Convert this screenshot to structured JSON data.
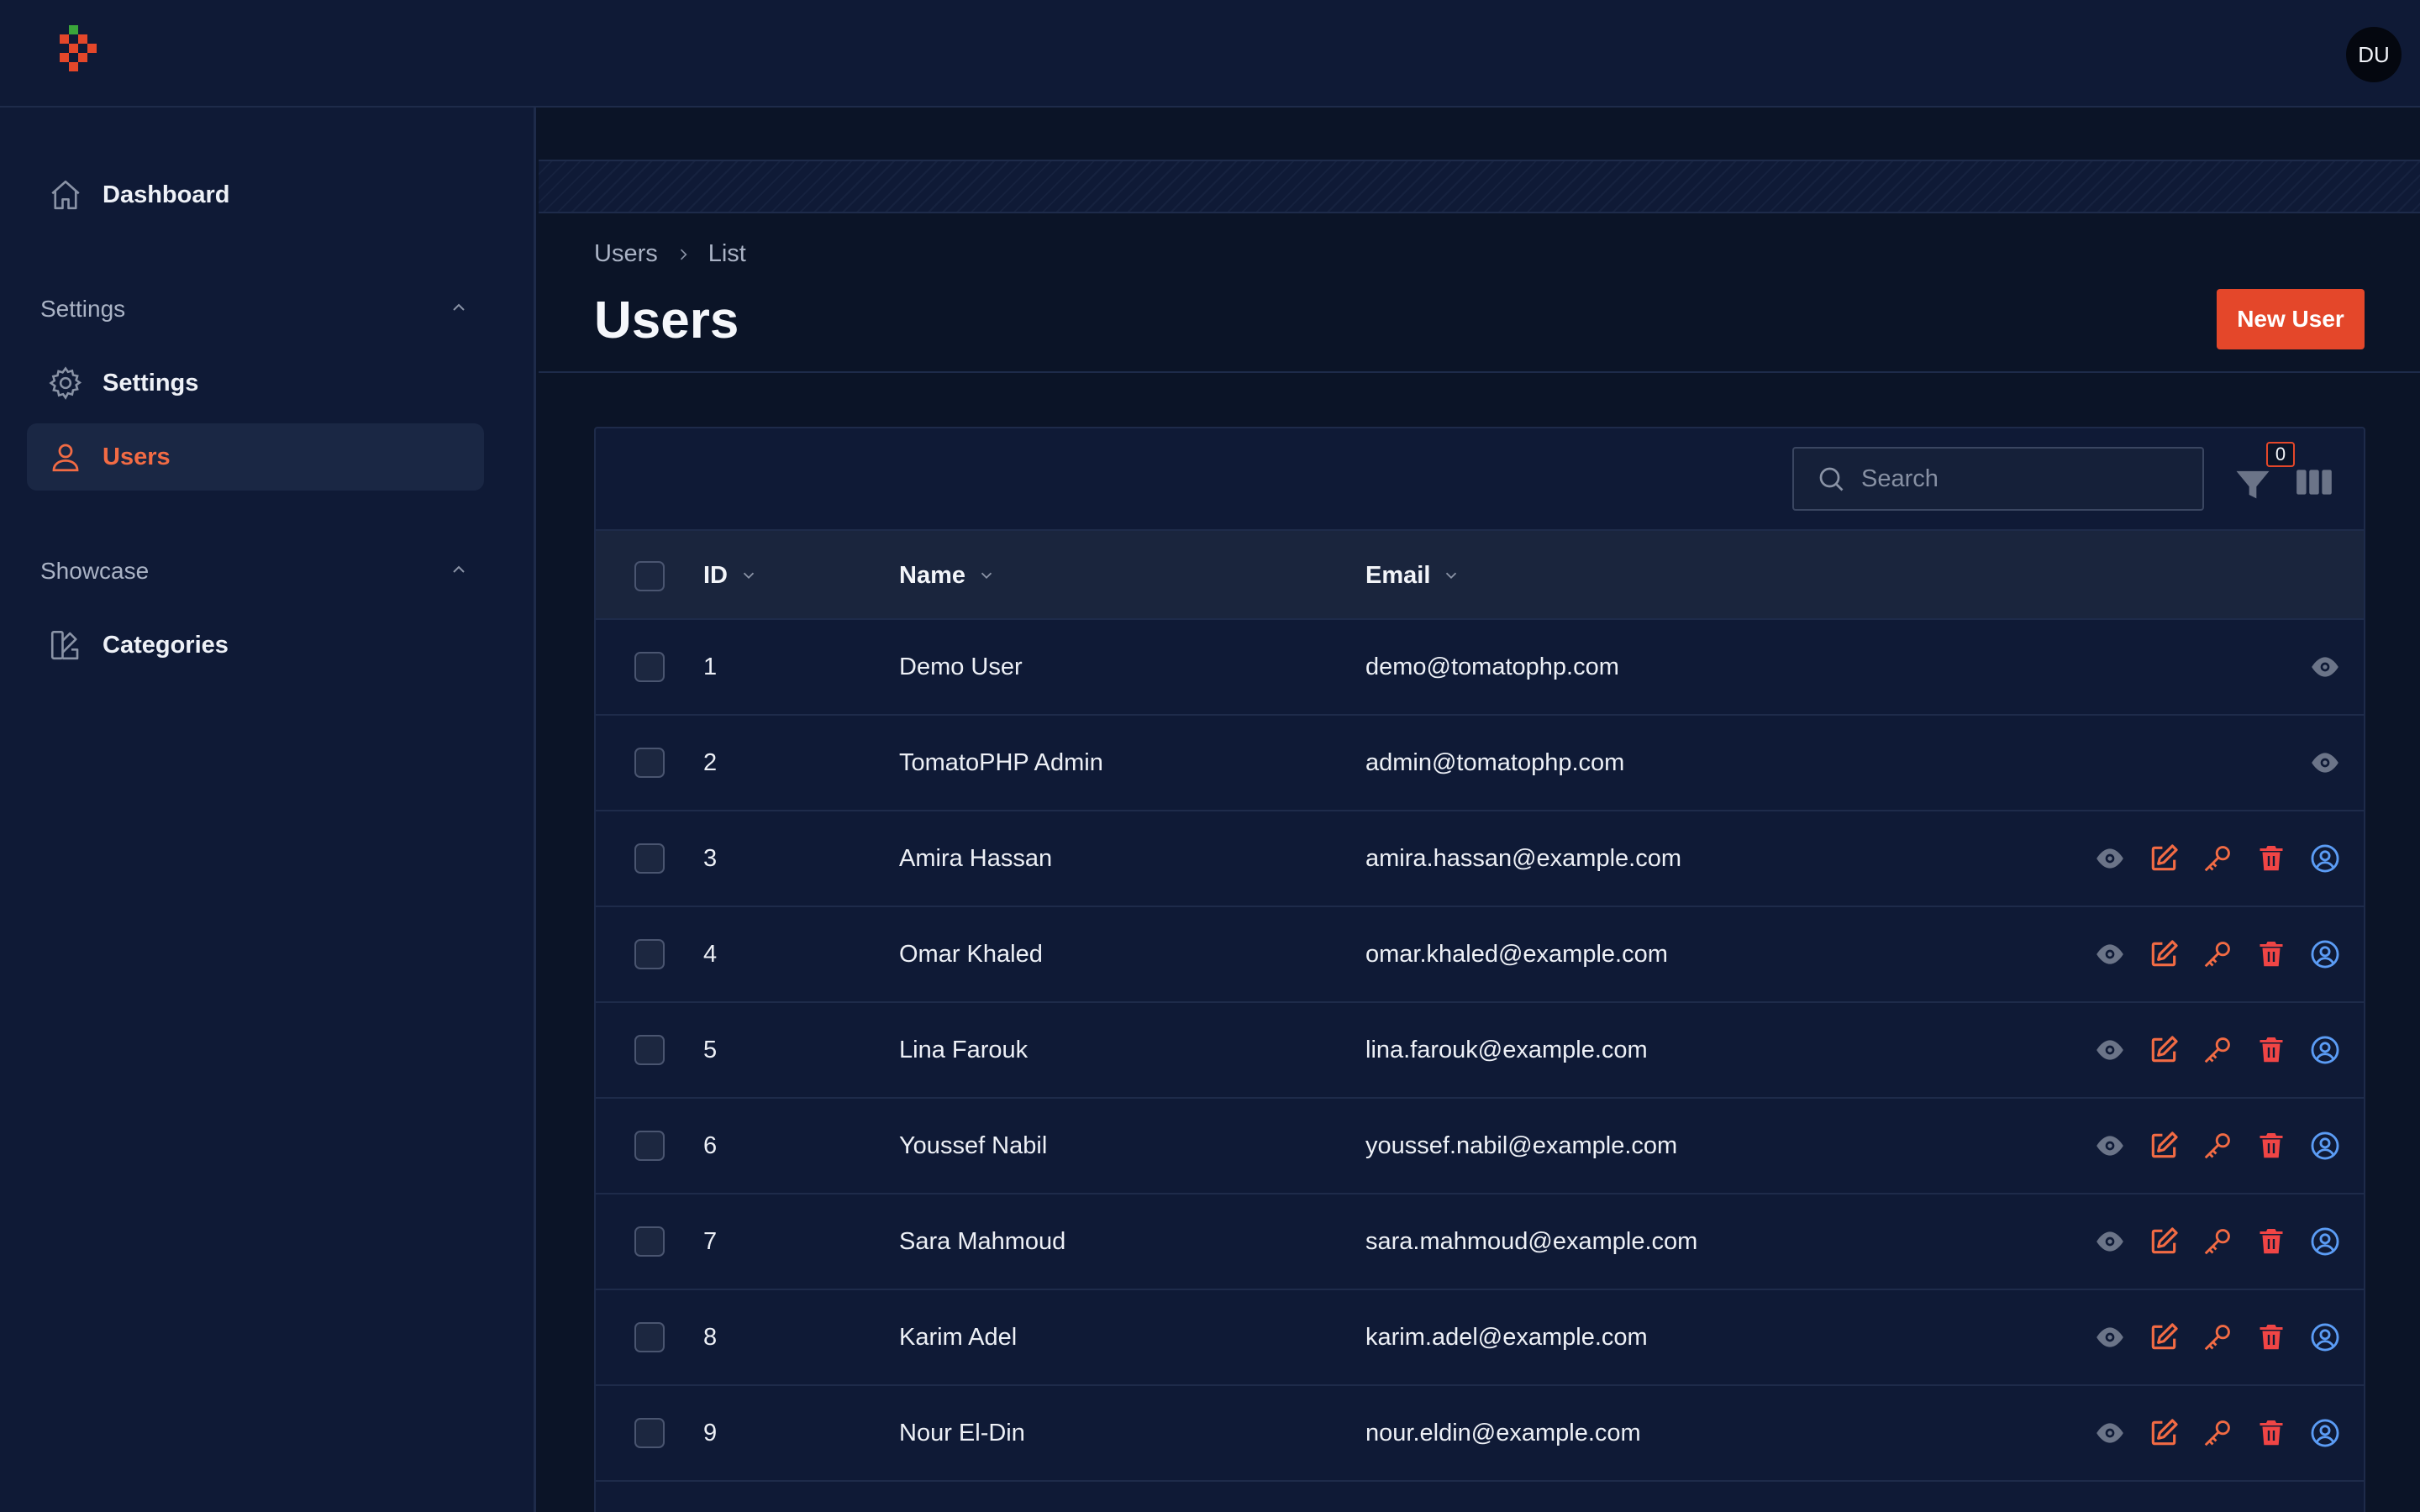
{
  "user": {
    "initials": "DU"
  },
  "sidebar": {
    "dashboard": "Dashboard",
    "groups": [
      {
        "label": "Settings",
        "items": [
          {
            "label": "Settings"
          },
          {
            "label": "Users"
          }
        ]
      },
      {
        "label": "Showcase",
        "items": [
          {
            "label": "Categories"
          }
        ]
      }
    ]
  },
  "breadcrumb": {
    "root": "Users",
    "current": "List"
  },
  "page": {
    "title": "Users",
    "new_button": "New User"
  },
  "table": {
    "search_placeholder": "Search",
    "filter_count": "0",
    "columns": {
      "id": "ID",
      "name": "Name",
      "email": "Email"
    },
    "rows": [
      {
        "id": "1",
        "name": "Demo User",
        "email": "demo@tomatophp.com"
      },
      {
        "id": "2",
        "name": "TomatoPHP Admin",
        "email": "admin@tomatophp.com"
      },
      {
        "id": "3",
        "name": "Amira Hassan",
        "email": "amira.hassan@example.com"
      },
      {
        "id": "4",
        "name": "Omar Khaled",
        "email": "omar.khaled@example.com"
      },
      {
        "id": "5",
        "name": "Lina Farouk",
        "email": "lina.farouk@example.com"
      },
      {
        "id": "6",
        "name": "Youssef Nabil",
        "email": "youssef.nabil@example.com"
      },
      {
        "id": "7",
        "name": "Sara Mahmoud",
        "email": "sara.mahmoud@example.com"
      },
      {
        "id": "8",
        "name": "Karim Adel",
        "email": "karim.adel@example.com"
      },
      {
        "id": "9",
        "name": "Nour El-Din",
        "email": "nour.eldin@example.com"
      }
    ]
  },
  "colors": {
    "accent": "#e4472a",
    "active": "#f26b44",
    "impersonate": "#5b9cf5",
    "view": "#6b7488"
  }
}
